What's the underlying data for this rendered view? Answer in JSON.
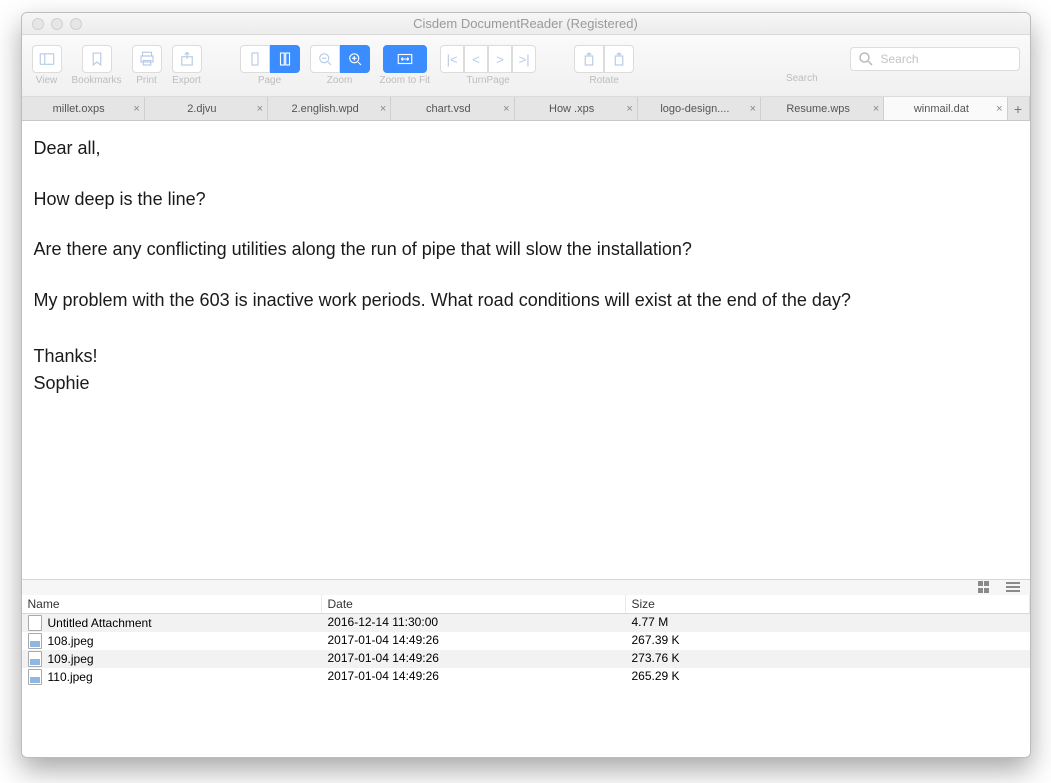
{
  "window": {
    "title": "Cisdem DocumentReader  (Registered)"
  },
  "toolbar": {
    "view": "View",
    "bookmarks": "Bookmarks",
    "print": "Print",
    "export": "Export",
    "page": "Page",
    "zoom": "Zoom",
    "zoom_to_fit": "Zoom to Fit",
    "turnpage": "TurnPage",
    "rotate": "Rotate",
    "search_label": "Search",
    "search_placeholder": "Search"
  },
  "tabs": [
    {
      "label": "millet.oxps",
      "active": false
    },
    {
      "label": "2.djvu",
      "active": false
    },
    {
      "label": "2.english.wpd",
      "active": false
    },
    {
      "label": "chart.vsd",
      "active": false
    },
    {
      "label": "How .xps",
      "active": false
    },
    {
      "label": "logo-design....",
      "active": false
    },
    {
      "label": "Resume.wps",
      "active": false
    },
    {
      "label": "winmail.dat",
      "active": true
    }
  ],
  "body": {
    "p1": "Dear all,",
    "p2": "How deep is the line?",
    "p3": "Are there any conflicting utilities along the run of pipe that will slow the installation?",
    "p4": "My problem with the 603 is inactive work periods. What road conditions will exist at the end of the day?",
    "p5": "Thanks!",
    "p6": "Sophie"
  },
  "attachments": {
    "headers": {
      "name": "Name",
      "date": "Date",
      "size": "Size"
    },
    "rows": [
      {
        "name": "Untitled Attachment",
        "date": "2016-12-14 11:30:00",
        "size": "4.77 M",
        "type": "doc"
      },
      {
        "name": "108.jpeg",
        "date": "2017-01-04 14:49:26",
        "size": "267.39 K",
        "type": "img"
      },
      {
        "name": "109.jpeg",
        "date": "2017-01-04 14:49:26",
        "size": "273.76 K",
        "type": "img"
      },
      {
        "name": "110.jpeg",
        "date": "2017-01-04 14:49:26",
        "size": "265.29 K",
        "type": "img"
      }
    ]
  }
}
